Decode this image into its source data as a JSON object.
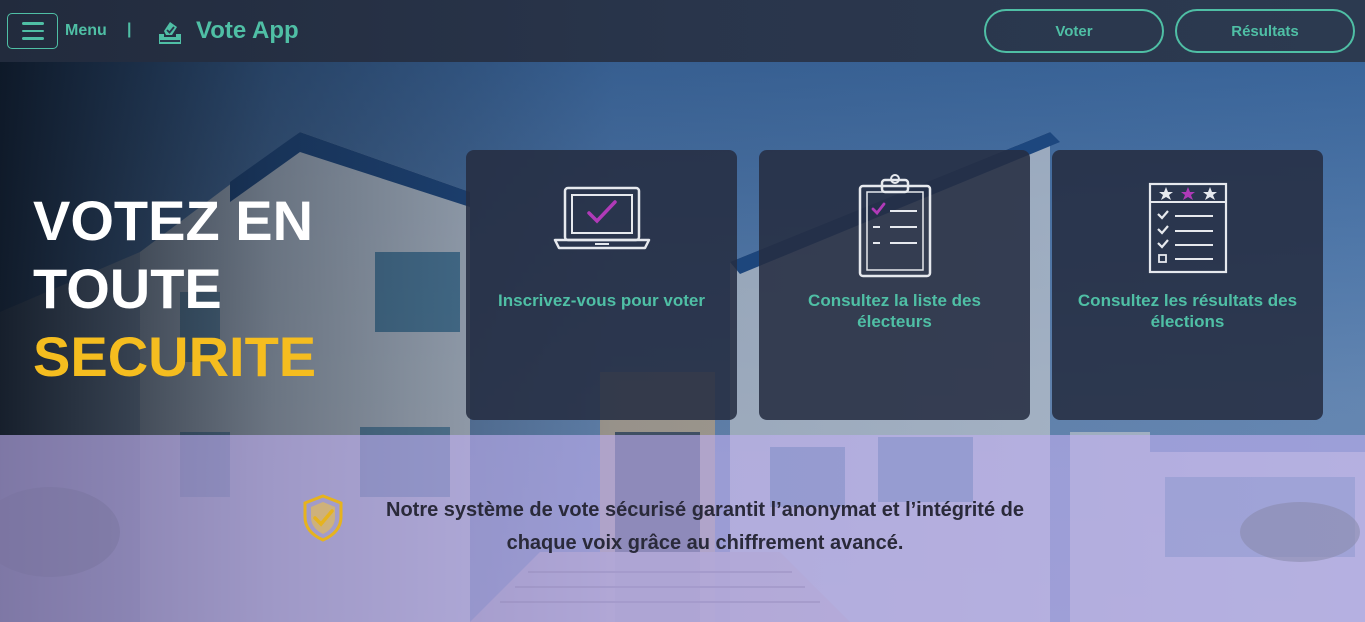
{
  "navbar": {
    "menu_label": "Menu",
    "separator": "|",
    "brand_title": "Vote App",
    "buttons": {
      "vote": "Voter",
      "results": "Résultats"
    }
  },
  "hero": {
    "headline_line1": "VOTEZ EN",
    "headline_line2": "TOUTE",
    "headline_accent": "SECURITE"
  },
  "cards": [
    {
      "icon": "laptop-check-icon",
      "title": "Inscrivez-vous pour voter"
    },
    {
      "icon": "clipboard-list-icon",
      "title": "Consultez la liste des électeurs"
    },
    {
      "icon": "results-checklist-icon",
      "title": "Consultez les résultats des élections"
    }
  ],
  "band": {
    "icon": "shield-check-icon",
    "text": "Notre système de vote sécurisé garantit l’anonymat et l’intégrité de chaque voix grâce au chiffrement avancé."
  },
  "colors": {
    "accent": "#4fbfa5",
    "highlight": "#f5bd1f",
    "checkmark": "#b03ab8",
    "nav_bg": "#29354b"
  }
}
